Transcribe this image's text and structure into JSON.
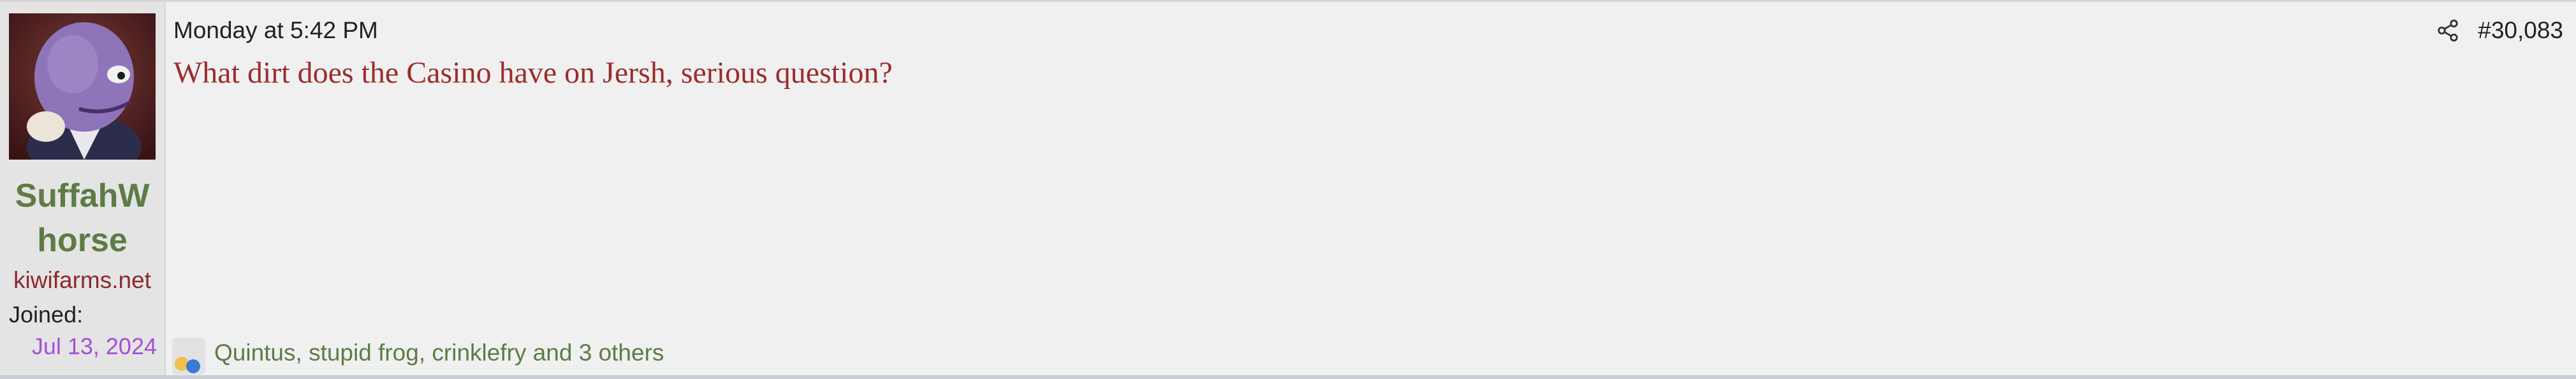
{
  "post": {
    "user": {
      "name_line1": "SuffahW",
      "name_line2": "horse",
      "title": "kiwifarms.net",
      "joined_label": "Joined:",
      "joined_date": "Jul 13, 2024"
    },
    "date": "Monday at 5:42 PM",
    "post_number": "#30,083",
    "message": "What dirt does the Casino have on Jersh, serious question?",
    "reactions_text": "Quintus, stupid frog, crinklefry and 3 others",
    "icons": {
      "share": "share-icon",
      "avatar": "avatar-image"
    },
    "colors": {
      "username": "#5e7b46",
      "user_title": "#8c2b2b",
      "joined_date": "#a64fd6",
      "message": "#9b2d2d",
      "reactions": "#5e7b46"
    }
  }
}
